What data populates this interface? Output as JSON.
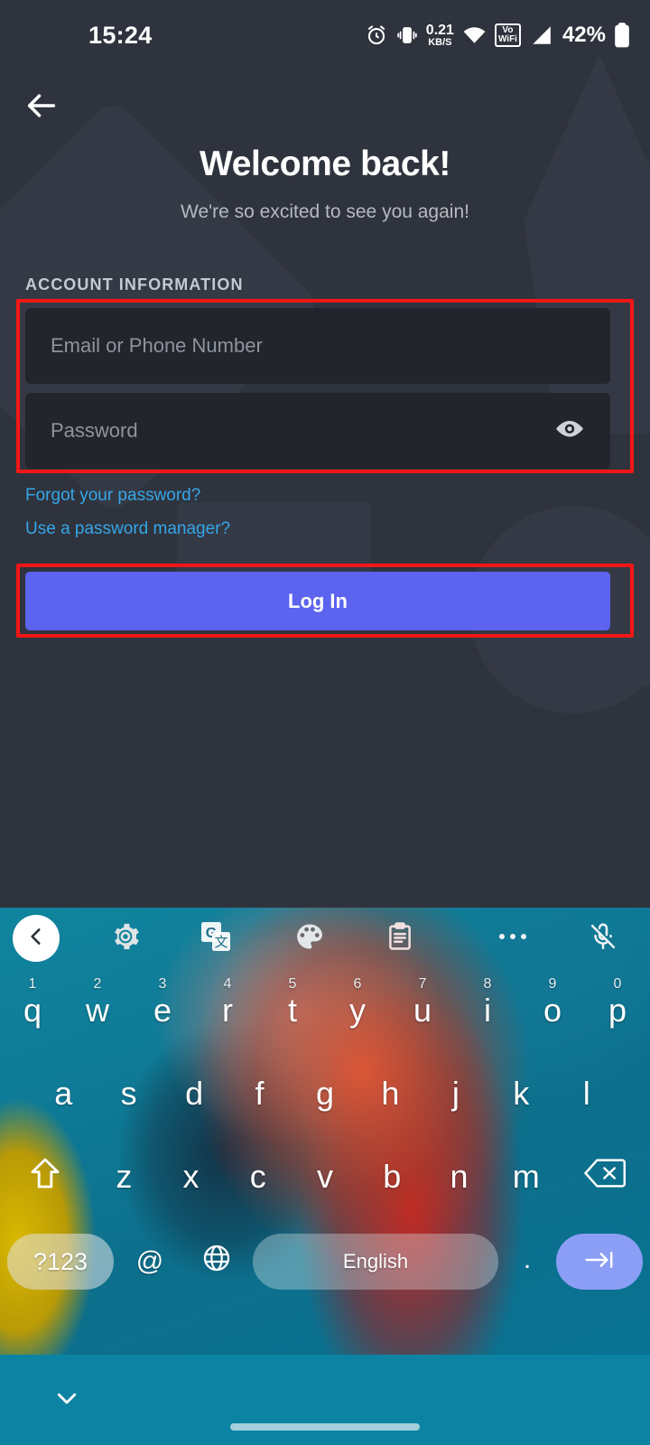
{
  "status_bar": {
    "time": "15:24",
    "network_speed_value": "0.21",
    "network_speed_unit": "KB/S",
    "vowifi_line1": "Vo",
    "vowifi_line2": "WiFi",
    "battery_percent": "42%",
    "icons": [
      "alarm-icon",
      "vibrate-icon",
      "network-speed-indicator",
      "wifi-icon",
      "vowifi-icon",
      "signal-icon",
      "battery-icon"
    ]
  },
  "app": {
    "back_icon": "arrow-left-icon",
    "title": "Welcome back!",
    "subtitle": "We're so excited to see you again!",
    "section_label": "ACCOUNT INFORMATION",
    "fields": [
      {
        "name": "email-or-phone",
        "placeholder": "Email or Phone Number",
        "value": ""
      },
      {
        "name": "password",
        "placeholder": "Password",
        "value": "",
        "trailing_icon": "eye-icon"
      }
    ],
    "links": [
      {
        "name": "forgot-password",
        "label": "Forgot your password?"
      },
      {
        "name": "password-manager",
        "label": "Use a password manager?"
      }
    ],
    "primary_button": {
      "label": "Log In",
      "color": "#5b63ef"
    },
    "annotation_color": "#f41616",
    "annotations": [
      "account-fields-highlight",
      "login-button-highlight"
    ]
  },
  "keyboard": {
    "toolbar": [
      {
        "name": "collapse-toolbar-button",
        "icon": "chevron-left-icon"
      },
      {
        "name": "settings-button",
        "icon": "gear-icon"
      },
      {
        "name": "translate-button",
        "icon": "google-translate-icon",
        "glyph": "G"
      },
      {
        "name": "theme-button",
        "icon": "palette-icon"
      },
      {
        "name": "clipboard-button",
        "icon": "clipboard-icon"
      },
      {
        "name": "more-button",
        "icon": "more-horizontal-icon"
      },
      {
        "name": "voice-input-button",
        "icon": "microphone-off-icon"
      }
    ],
    "row1": [
      {
        "key": "q",
        "num": "1"
      },
      {
        "key": "w",
        "num": "2"
      },
      {
        "key": "e",
        "num": "3"
      },
      {
        "key": "r",
        "num": "4"
      },
      {
        "key": "t",
        "num": "5"
      },
      {
        "key": "y",
        "num": "6"
      },
      {
        "key": "u",
        "num": "7"
      },
      {
        "key": "i",
        "num": "8"
      },
      {
        "key": "o",
        "num": "9"
      },
      {
        "key": "p",
        "num": "0"
      }
    ],
    "row2": [
      "a",
      "s",
      "d",
      "f",
      "g",
      "h",
      "j",
      "k",
      "l"
    ],
    "row3": [
      "z",
      "x",
      "c",
      "v",
      "b",
      "n",
      "m"
    ],
    "shift_icon": "shift-up-icon",
    "backspace_icon": "backspace-icon",
    "row4": {
      "symbols_label": "?123",
      "at_label": "@",
      "globe_icon": "globe-icon",
      "space_label": "English",
      "period_label": ".",
      "enter_icon": "tab-next-icon"
    }
  },
  "nav_bar": {
    "dismiss_icon": "chevron-down-icon",
    "home_indicator": "home-pill"
  }
}
